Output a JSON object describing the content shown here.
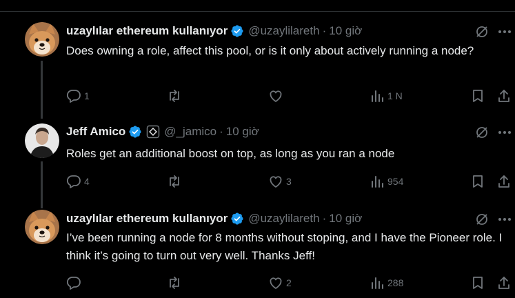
{
  "colors": {
    "background": "#000000",
    "text": "#e7e9ea",
    "muted": "#71767b",
    "verified": "#1d9bf0",
    "divider": "#2f3336"
  },
  "tweets": [
    {
      "avatar": "shiba-dog-avatar",
      "name": "uzaylılar ethereum kullanıyor",
      "handle": "@uzaylilareth",
      "sep": "·",
      "time": "10 giờ",
      "text": "Does owning a role, affect this pool, or is it only about actively running a node?",
      "replies": "1",
      "retweets": "",
      "likes": "",
      "views": "1 N"
    },
    {
      "avatar": "man-portrait-avatar",
      "name": "Jeff Amico",
      "handle": "@_jamico",
      "sep": "·",
      "time": "10 giờ",
      "text": "Roles get an additional boost on top, as long as you ran a node",
      "replies": "4",
      "retweets": "",
      "likes": "3",
      "views": "954"
    },
    {
      "avatar": "shiba-dog-avatar",
      "name": "uzaylılar ethereum kullanıyor",
      "handle": "@uzaylilareth",
      "sep": "·",
      "time": "10 giờ",
      "text": "I’ve been running a node for 8 months without stoping, and I have the Pioneer role. I think it’s going to turn out very well. Thanks Jeff!",
      "replies": "",
      "retweets": "",
      "likes": "2",
      "views": "288"
    }
  ]
}
